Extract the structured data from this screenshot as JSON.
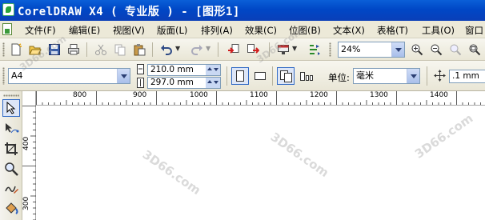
{
  "window": {
    "title": "CorelDRAW X4 ( 专业版 ) - [图形1]"
  },
  "menu": {
    "items": [
      "文件(F)",
      "编辑(E)",
      "视图(V)",
      "版面(L)",
      "排列(A)",
      "效果(C)",
      "位图(B)",
      "文本(X)",
      "表格(T)",
      "工具(O)",
      "窗口"
    ]
  },
  "toolbar": {
    "zoom_value": "24%"
  },
  "property_bar": {
    "paper_size": "A4",
    "width_value": "210.0 mm",
    "height_value": "297.0 mm",
    "units_label": "单位:",
    "units_value": "毫米",
    "nudge_value": ".1 mm"
  },
  "rulers": {
    "horizontal_labels": [
      "800",
      "900",
      "1000",
      "1100",
      "1200",
      "1300",
      "1400"
    ],
    "vertical_labels": [
      "400",
      "300"
    ]
  },
  "watermarks": [
    "3D66.com",
    "3D66.com",
    "3D66.com",
    "3D66.com",
    "3D66.com"
  ],
  "icons": {
    "toolbar": [
      "new-icon",
      "open-icon",
      "save-icon",
      "print-icon",
      "cut-icon",
      "copy-icon",
      "paste-icon",
      "undo-icon",
      "redo-icon",
      "import-icon",
      "export-icon",
      "launcher-icon",
      "options-icon",
      "zoom-in-icon",
      "zoom-out-icon",
      "zoom-page-icon",
      "zoom-fit-icon"
    ],
    "toolbox": [
      "pick-tool-icon",
      "shape-tool-icon",
      "crop-tool-icon",
      "zoom-tool-icon",
      "freehand-tool-icon",
      "smart-fill-icon"
    ]
  }
}
